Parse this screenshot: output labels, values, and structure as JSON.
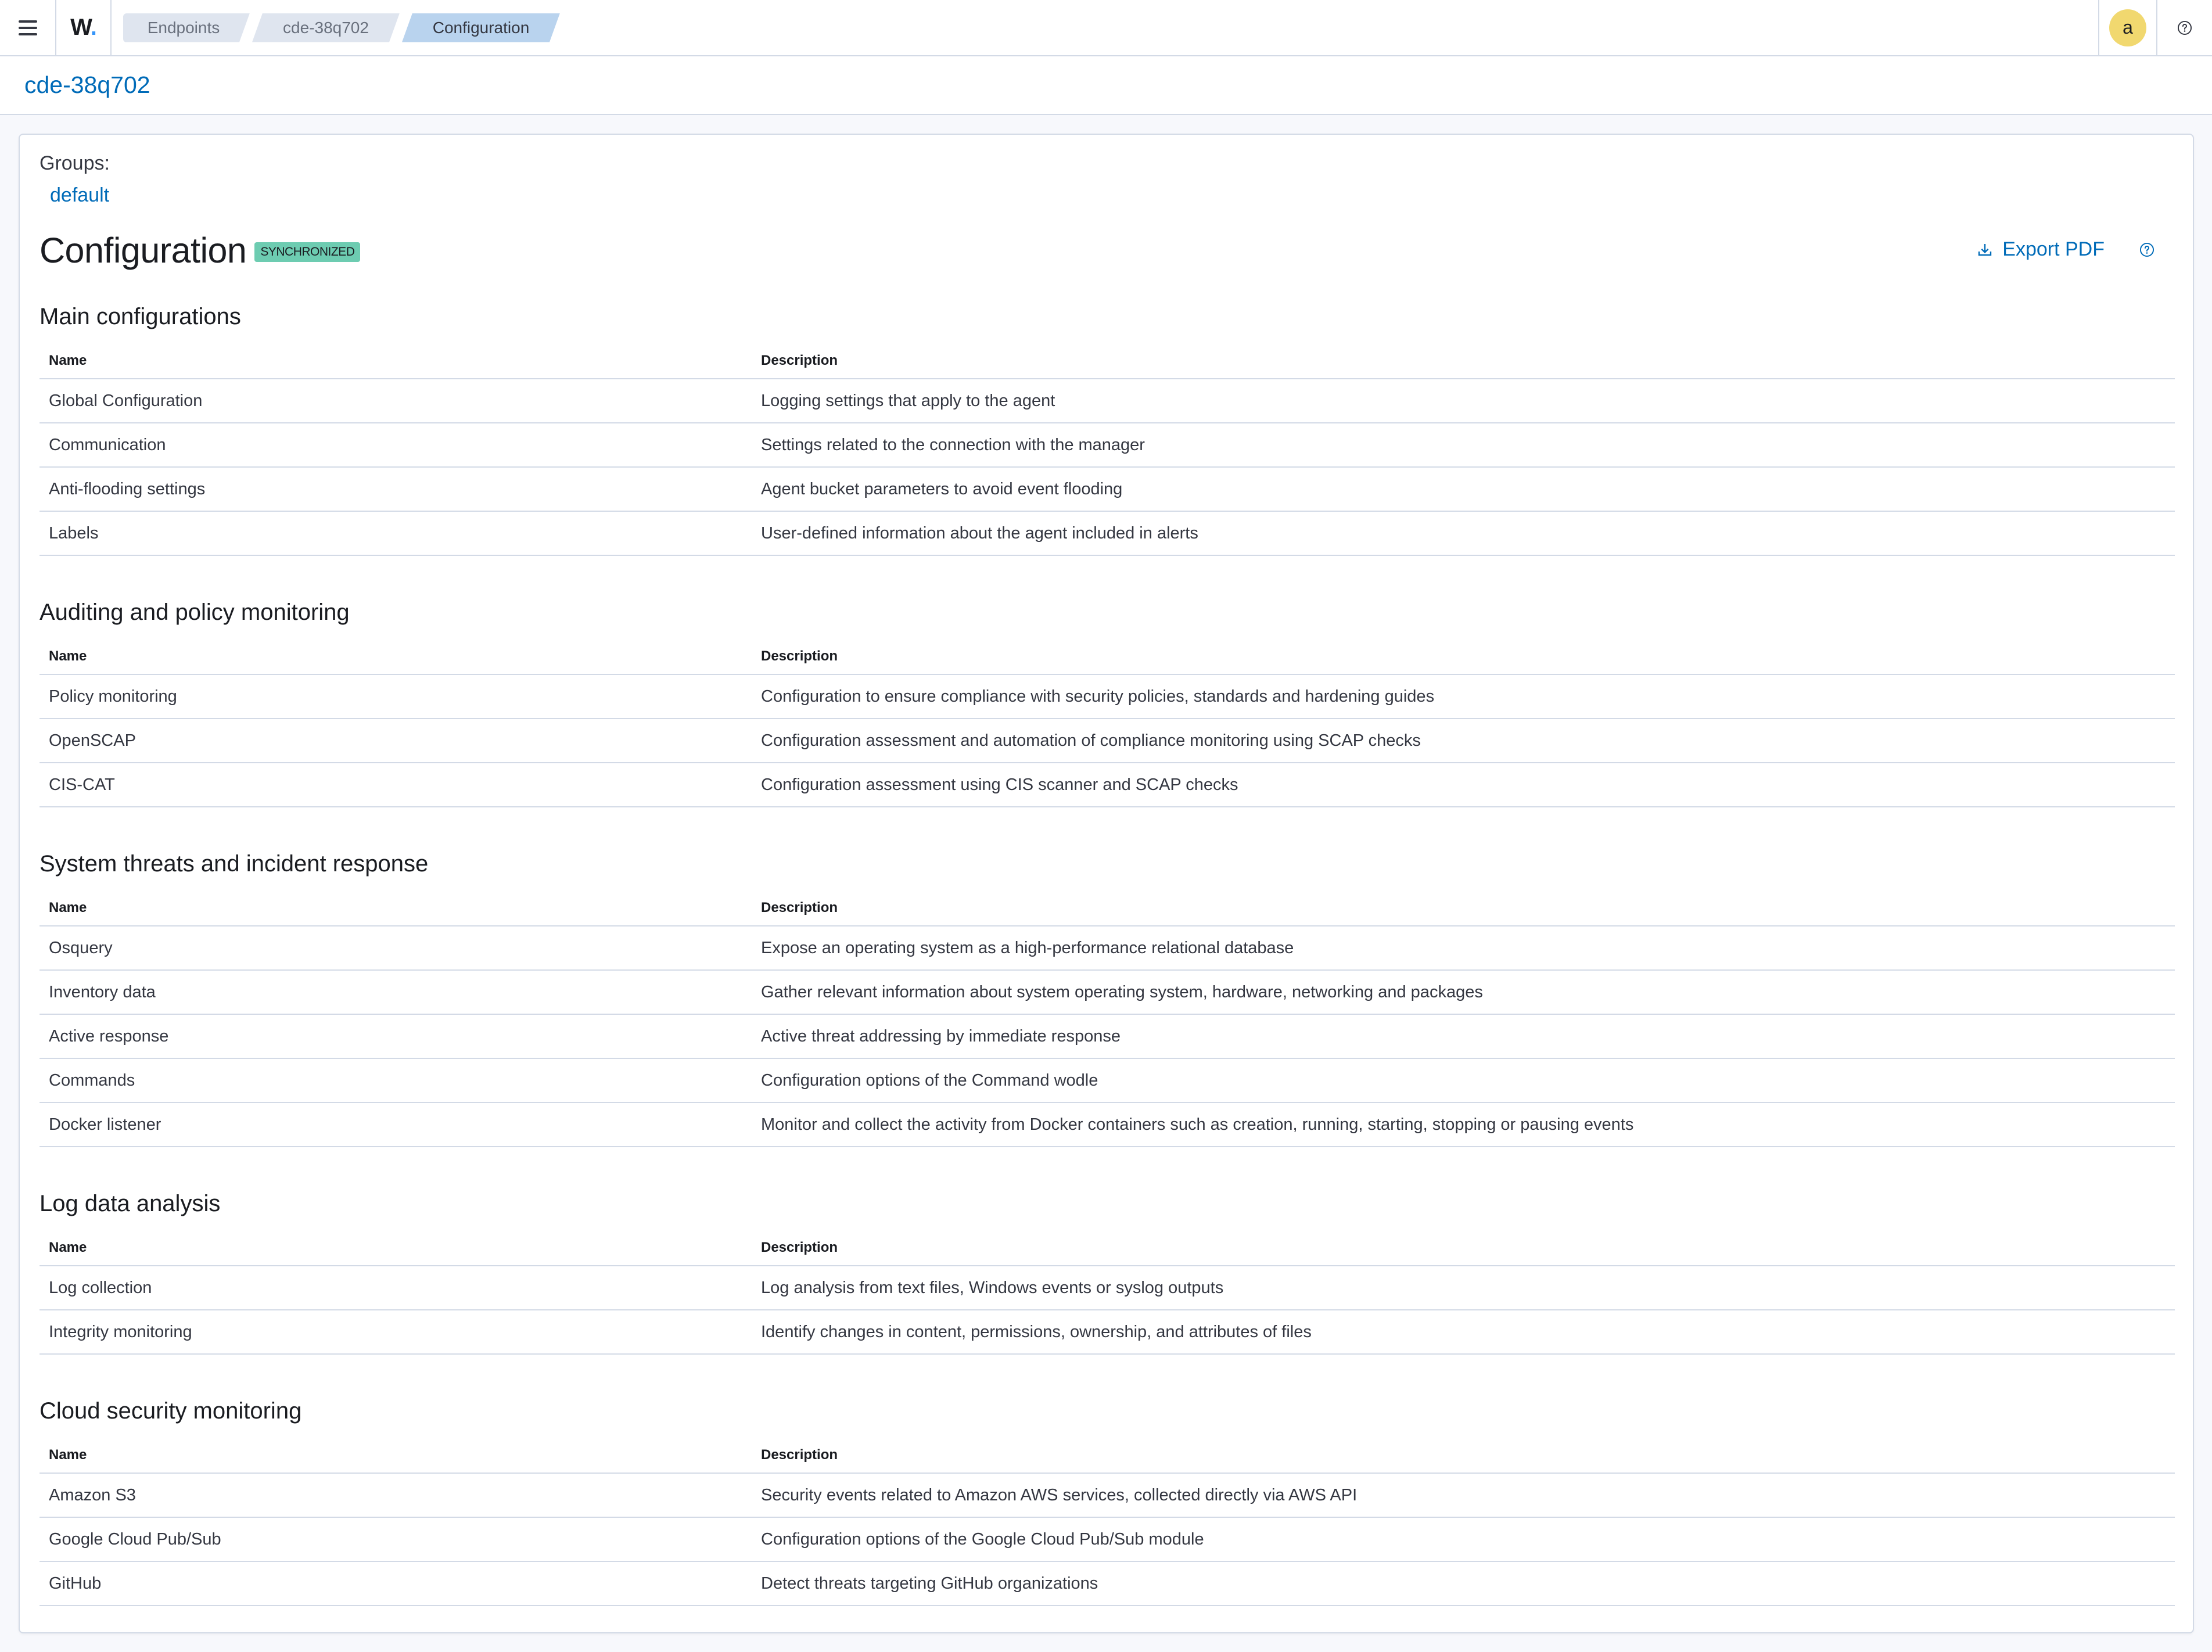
{
  "header": {
    "logo": "W",
    "breadcrumbs": [
      "Endpoints",
      "cde-38q702",
      "Configuration"
    ],
    "avatar_letter": "a"
  },
  "page": {
    "agent_name": "cde-38q702"
  },
  "panel": {
    "groups_label": "Groups:",
    "group": "default",
    "title": "Configuration",
    "status_badge": "SYNCHRONIZED",
    "export_label": "Export PDF",
    "columns": {
      "name": "Name",
      "description": "Description"
    },
    "sections": [
      {
        "title": "Main configurations",
        "rows": [
          {
            "name": "Global Configuration",
            "description": "Logging settings that apply to the agent"
          },
          {
            "name": "Communication",
            "description": "Settings related to the connection with the manager"
          },
          {
            "name": "Anti-flooding settings",
            "description": "Agent bucket parameters to avoid event flooding"
          },
          {
            "name": "Labels",
            "description": "User-defined information about the agent included in alerts"
          }
        ]
      },
      {
        "title": "Auditing and policy monitoring",
        "rows": [
          {
            "name": "Policy monitoring",
            "description": "Configuration to ensure compliance with security policies, standards and hardening guides"
          },
          {
            "name": "OpenSCAP",
            "description": "Configuration assessment and automation of compliance monitoring using SCAP checks"
          },
          {
            "name": "CIS-CAT",
            "description": "Configuration assessment using CIS scanner and SCAP checks"
          }
        ]
      },
      {
        "title": "System threats and incident response",
        "rows": [
          {
            "name": "Osquery",
            "description": "Expose an operating system as a high-performance relational database"
          },
          {
            "name": "Inventory data",
            "description": "Gather relevant information about system operating system, hardware, networking and packages"
          },
          {
            "name": "Active response",
            "description": "Active threat addressing by immediate response"
          },
          {
            "name": "Commands",
            "description": "Configuration options of the Command wodle"
          },
          {
            "name": "Docker listener",
            "description": "Monitor and collect the activity from Docker containers such as creation, running, starting, stopping or pausing events"
          }
        ]
      },
      {
        "title": "Log data analysis",
        "rows": [
          {
            "name": "Log collection",
            "description": "Log analysis from text files, Windows events or syslog outputs"
          },
          {
            "name": "Integrity monitoring",
            "description": "Identify changes in content, permissions, ownership, and attributes of files"
          }
        ]
      },
      {
        "title": "Cloud security monitoring",
        "rows": [
          {
            "name": "Amazon S3",
            "description": "Security events related to Amazon AWS services, collected directly via AWS API"
          },
          {
            "name": "Google Cloud Pub/Sub",
            "description": "Configuration options of the Google Cloud Pub/Sub module"
          },
          {
            "name": "GitHub",
            "description": "Detect threats targeting GitHub organizations"
          }
        ]
      }
    ]
  },
  "colors": {
    "accent": "#006bb8",
    "badge": "#6dccb1",
    "avatar": "#f1d86f",
    "breadcrumb_current": "#b9d3ee"
  }
}
